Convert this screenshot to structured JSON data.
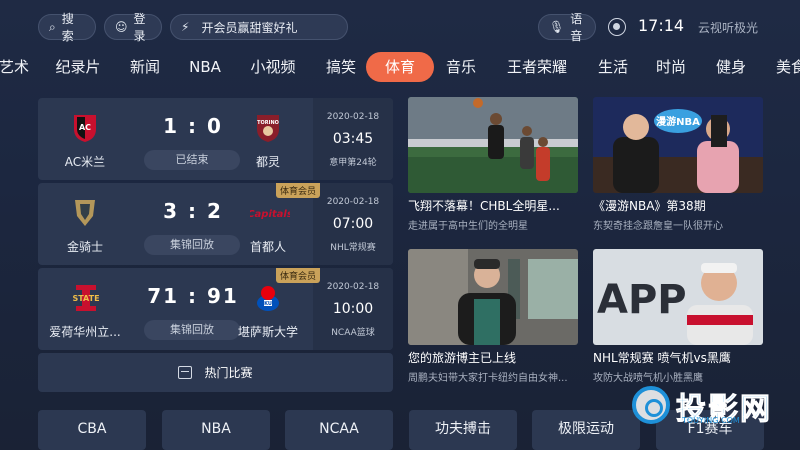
{
  "topbar": {
    "search_label": "搜索",
    "login_label": "登录",
    "promo_label": "开会员赢甜蜜好礼",
    "voice_label": "语音",
    "time": "17:14",
    "brand": "云视听极光"
  },
  "nav": {
    "items": [
      "艺术",
      "纪录片",
      "新闻",
      "NBA",
      "小视频",
      "搞笑",
      "体育",
      "音乐",
      "王者荣耀",
      "生活",
      "时尚",
      "健身",
      "美食"
    ],
    "active": "体育"
  },
  "matches": [
    {
      "home": "AC米兰",
      "away": "都灵",
      "score": "1 : 0",
      "status": "已结束",
      "date": "2020-02-18",
      "time": "03:45",
      "league": "意甲第24轮",
      "badge": "",
      "home_logo_text": "AC",
      "away_logo_text": "TO"
    },
    {
      "home": "金骑士",
      "away": "首都人",
      "score": "3 : 2",
      "status": "集锦回放",
      "date": "2020-02-18",
      "time": "07:00",
      "league": "NHL常规赛",
      "badge": "体育会员",
      "home_logo_text": "V",
      "away_logo_text": "Capitals"
    },
    {
      "home": "爱荷华州立...",
      "away": "堪萨斯大学",
      "score": "71 : 91",
      "status": "集锦回放",
      "date": "2020-02-18",
      "time": "10:00",
      "league": "NCAA篮球",
      "badge": "体育会员",
      "home_logo_text": "STATE",
      "away_logo_text": "KU"
    }
  ],
  "hot_label": "热门比赛",
  "videos": [
    {
      "title": "飞翔不落幕！CHBL全明星...",
      "subtitle": "走进属于高中生们的全明星"
    },
    {
      "title": "《漫游NBA》第38期",
      "subtitle": "东契奇挂念跟詹皇一队很开心"
    },
    {
      "title": "您的旅游博主已上线",
      "subtitle": "周鹏夫妇带大家打卡纽约自由女神..."
    },
    {
      "title": "NHL常规赛 喷气机vs黑鹰",
      "subtitle": "攻防大战喷气机小胜黑鹰"
    }
  ],
  "bottom_buttons": [
    "CBA",
    "NBA",
    "NCAA",
    "功夫搏击",
    "极限运动",
    "F1赛车"
  ],
  "watermark": {
    "text": "投影网",
    "domain": "TOUYING.COM"
  },
  "thumb_text": {
    "nba_logo": "漫游NBA",
    "app_banner": "APP"
  }
}
